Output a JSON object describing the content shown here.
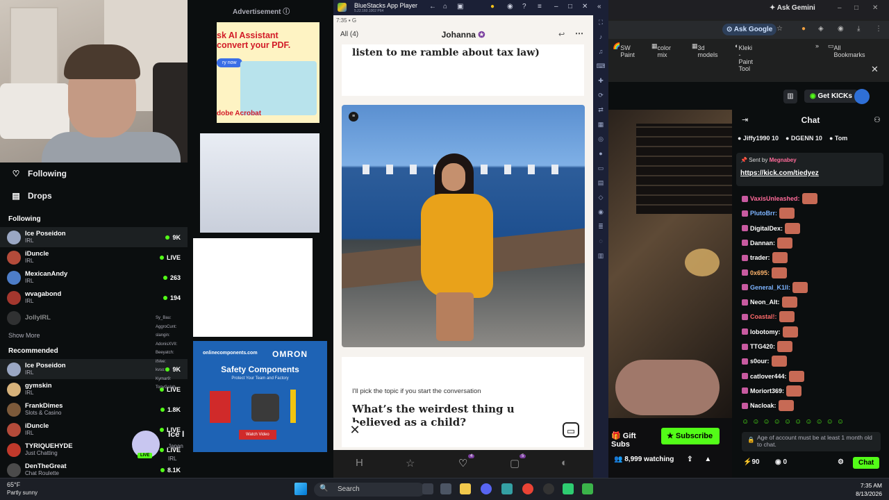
{
  "left_sidebar": {
    "nav": [
      {
        "label": "Following",
        "icon": "heart-icon"
      },
      {
        "label": "Drops",
        "icon": "drops-icon"
      }
    ],
    "following_title": "Following",
    "following": [
      {
        "name": "Ice Poseidon",
        "category": "IRL",
        "meta": "9K",
        "color": "#9aa7c4"
      },
      {
        "name": "iDuncle",
        "category": "IRL",
        "meta": "LIVE",
        "color": "#b44b3a"
      },
      {
        "name": "MexicanAndy",
        "category": "IRL",
        "meta": "263",
        "color": "#4d7dc8"
      },
      {
        "name": "wvagabond",
        "category": "IRL",
        "meta": "194",
        "color": "#a4372e"
      },
      {
        "name": "JollyIRL",
        "category": "",
        "meta": "",
        "color": "#555555"
      }
    ],
    "show_more": "Show More",
    "recommended_title": "Recommended",
    "recommended": [
      {
        "name": "Ice Poseidon",
        "category": "IRL",
        "meta": "9K",
        "color": "#9aa7c4"
      },
      {
        "name": "gymskin",
        "category": "IRL",
        "meta": "LIVE",
        "color": "#d7b27a"
      },
      {
        "name": "FrankDimes",
        "category": "Slots & Casino",
        "meta": "1.8K",
        "color": "#7d5a3a"
      },
      {
        "name": "iDuncle",
        "category": "IRL",
        "meta": "LIVE",
        "color": "#b44b3a"
      },
      {
        "name": "TYRIQUEHYDE",
        "category": "Just Chatting",
        "meta": "LIVE",
        "color": "#c0392b"
      },
      {
        "name": "DenTheGreat",
        "category": "Chat Roulette",
        "meta": "8.1K",
        "color": "#4b4b4b"
      }
    ]
  },
  "mini_chat": [
    "Sy_Bau:",
    "AggroCunt:",
    "slangin:",
    "AdonisXVII:",
    "Beeyatch:",
    "itVee:",
    "kvso:",
    "Kymar9:",
    "TonyGalah"
  ],
  "live_card": {
    "name": "Ice I",
    "line1": "Japan",
    "line2": "IRL",
    "badge": "LIVE"
  },
  "ads": {
    "label": "Advertisement",
    "ad1_line1": "sk AI Assistant",
    "ad1_line2": "convert your PDF.",
    "ad1_btn": "ry now",
    "ad1_brand": "dobe Acrobat",
    "ad4_site": "onlinecomponents.com",
    "ad4_brand": "OMRON",
    "ad4_headline": "Safety Components",
    "ad4_sub": "Protect Your Team and Factory",
    "ad4_btn": "Watch Video"
  },
  "bluestacks": {
    "title": "BlueStacks App Player",
    "version": "5.22.160.1002 P64",
    "status_time": "7:35",
    "tab_all": "All (4)",
    "match_name": "Johanna",
    "text_card": "listen to me ramble about tax law)",
    "prompt_label": "I'll pick the topic if you start the conversation",
    "prompt_question": "What’s the weirdest thing u believed as a child?",
    "likes_badge": "4",
    "chat_badge": "5"
  },
  "browser": {
    "gemini": "Ask Gemini",
    "ask_google": "Ask Google",
    "bookmarks": [
      "SW Paint",
      "color mix",
      "3d models",
      "Kleki - Paint Tool",
      "All Bookmarks"
    ]
  },
  "kick_header": {
    "kicks_btn": "Get KICKs"
  },
  "chat": {
    "title": "Chat",
    "gifters": [
      {
        "name": "Jiffy1990",
        "count": "10"
      },
      {
        "name": "DGENN",
        "count": "10"
      },
      {
        "name": "Tom",
        "count": ""
      }
    ],
    "pinned_prefix": "Sent by",
    "pinned_user": "Megnabey",
    "pinned_link": "https://kick.com/tiedyez",
    "messages": [
      {
        "user": "VaxisUnleashed:",
        "color": "#ff6b9a"
      },
      {
        "user": "PlutoBrr:",
        "color": "#7db4ff"
      },
      {
        "user": "DigitalDex:",
        "color": "#ffffff"
      },
      {
        "user": "Dannan:",
        "color": "#ffffff"
      },
      {
        "user": "trader:",
        "color": "#ffffff"
      },
      {
        "user": "0x695:",
        "color": "#ffb46b"
      },
      {
        "user": "General_K1ll:",
        "color": "#7db4ff"
      },
      {
        "user": "Neon_Alt:",
        "color": "#ffffff"
      },
      {
        "user": "Coastal!:",
        "color": "#ff6b6b"
      },
      {
        "user": "lobotomy:",
        "color": "#ffffff"
      },
      {
        "user": "TTG420:",
        "color": "#ffffff"
      },
      {
        "user": "s0our:",
        "color": "#ffffff"
      },
      {
        "user": "catlover444:",
        "color": "#ffffff"
      },
      {
        "user": "Moriort369:",
        "color": "#ffffff"
      },
      {
        "user": "Nacloak:",
        "color": "#ffffff"
      }
    ],
    "gift_subs": "Gift Subs",
    "subscribe": "Subscribe",
    "watching": "8,999 watching",
    "input_placeholder": "Age of account must be at least 1 month old to chat.",
    "points": "90",
    "zero": "0",
    "chat_btn": "Chat"
  },
  "taskbar": {
    "temp": "65°F",
    "weather": "Partly sunny",
    "search": "Search",
    "time": "7:35 AM",
    "date": "8/13/2026"
  },
  "colors": {
    "kick_green": "#53fc18",
    "bluestacks_dark": "#1b2036"
  }
}
